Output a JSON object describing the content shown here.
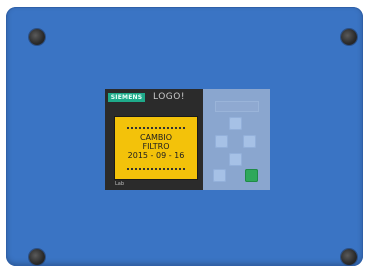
{
  "device": {
    "brand": "SIEMENS",
    "model": "LOGO!",
    "lcd_lines": [
      "CAMBIO",
      "FILTRO",
      "2015 - 09 - 16"
    ],
    "small_label": "Lab"
  },
  "colors": {
    "panel": "#3a74c4",
    "lcd": "#f3c20a",
    "brand_badge": "#1faa8a",
    "ok_key": "#2ea85b"
  },
  "icons": {
    "screws": [
      "screw-icon",
      "screw-icon",
      "screw-icon",
      "screw-icon"
    ],
    "keys": [
      "arrow-up-key",
      "arrow-left-key",
      "arrow-right-key",
      "arrow-down-key",
      "esc-key",
      "ok-key"
    ]
  }
}
